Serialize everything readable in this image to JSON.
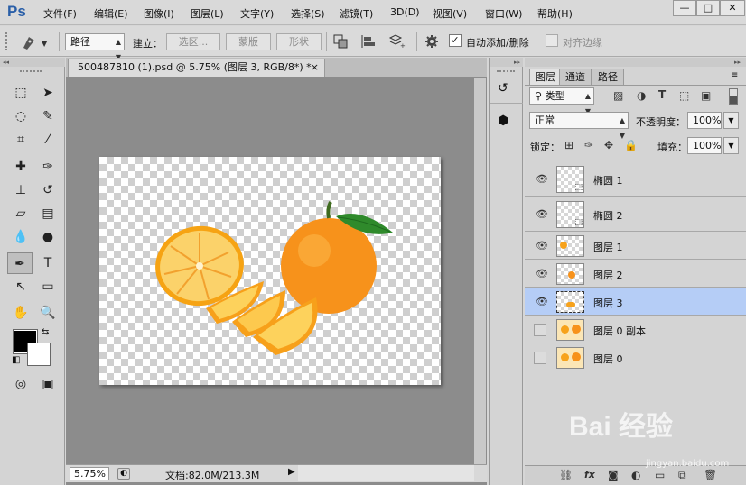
{
  "app": {
    "logo": "Ps"
  },
  "menus": [
    "文件(F)",
    "编辑(E)",
    "图像(I)",
    "图层(L)",
    "文字(Y)",
    "选择(S)",
    "滤镜(T)",
    "3D(D)",
    "视图(V)",
    "窗口(W)",
    "帮助(H)"
  ],
  "window_controls": {
    "minimize": "—",
    "maximize": "□",
    "close": "✕"
  },
  "options": {
    "path_mode": "路径",
    "make_label": "建立：",
    "selection_button": "选区...",
    "mask_button": "蒙版",
    "shape_button": "形状",
    "auto_add_delete": "自动添加/删除",
    "auto_add_delete_checked": true,
    "align_edges": "对齐边缘",
    "align_edges_checked": false
  },
  "document": {
    "tab_title": "500487810 (1).psd @ 5.75% (图层 3, RGB/8*) *",
    "close": "×"
  },
  "status": {
    "zoom": "5.75%",
    "doc_info": "文档:82.0M/213.3M"
  },
  "layers_panel": {
    "tabs": [
      "图层",
      "通道",
      "路径"
    ],
    "filter_type": "类型",
    "blend_mode": "正常",
    "opacity_label": "不透明度：",
    "opacity_value": "100%",
    "lock_label": "锁定：",
    "fill_label": "填充：",
    "fill_value": "100%",
    "layers": [
      {
        "name": "椭圆 1",
        "visible": true,
        "selected": false
      },
      {
        "name": "椭圆 2",
        "visible": true,
        "selected": false
      },
      {
        "name": "图层 1",
        "visible": true,
        "selected": false
      },
      {
        "name": "图层 2",
        "visible": true,
        "selected": false
      },
      {
        "name": "图层 3",
        "visible": true,
        "selected": true
      },
      {
        "name": "图层 0 副本",
        "visible": false,
        "selected": false
      },
      {
        "name": "图层 0",
        "visible": false,
        "selected": false
      }
    ],
    "footer_icons": [
      "link-icon",
      "fx-icon",
      "mask-icon",
      "adjustment-icon",
      "folder-icon",
      "new-layer-icon",
      "trash-icon"
    ],
    "footer_fx": "fx"
  },
  "watermark": {
    "text": "Bai 经验",
    "url": "jingyan.baidu.com"
  },
  "colors": {
    "accent": "#2a5fa8",
    "selected_row": "#b5cdf6",
    "orange": "#f7a21b"
  }
}
